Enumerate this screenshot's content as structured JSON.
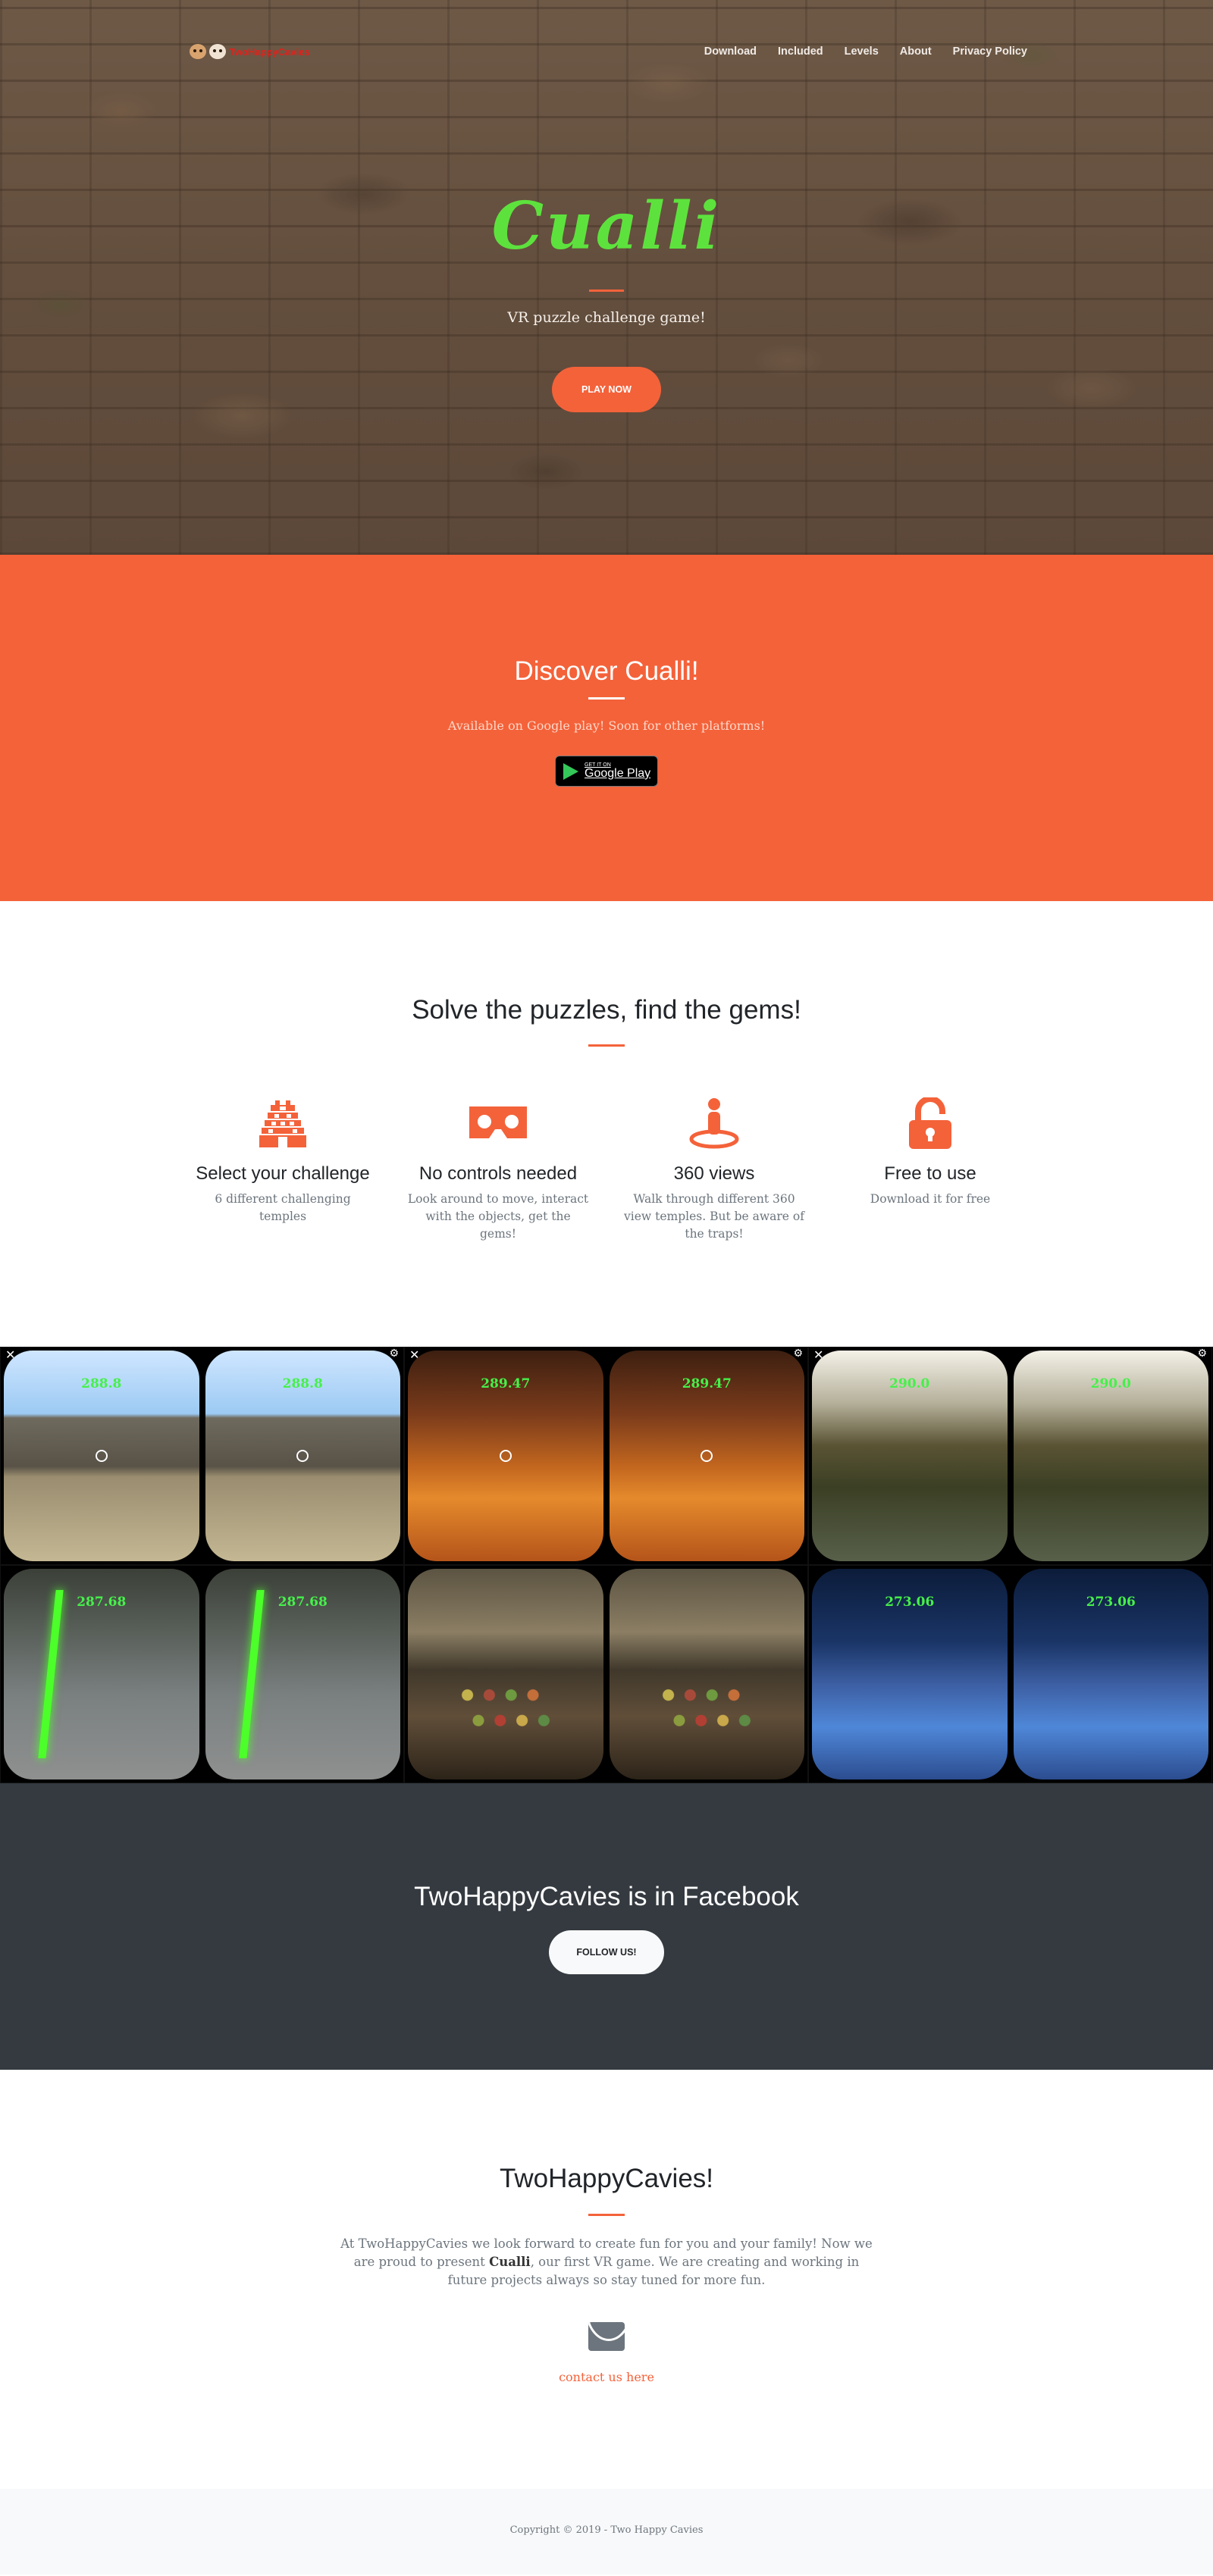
{
  "nav": {
    "logo_text": "TwoHappyCavies",
    "links": [
      "Download",
      "Included",
      "Levels",
      "About",
      "Privacy Policy"
    ]
  },
  "hero": {
    "title": "Cualli",
    "subtitle": "VR puzzle challenge game!",
    "cta": "PLAY NOW"
  },
  "discover": {
    "title": "Discover Cualli!",
    "text": "Available on Google play! Soon for other platforms!",
    "badge_small": "GET IT ON",
    "badge_big": "Google Play"
  },
  "features": {
    "title": "Solve the puzzles, find the gems!",
    "items": [
      {
        "icon": "temple-icon",
        "title": "Select your challenge",
        "text": "6 different challenging temples"
      },
      {
        "icon": "vr-headset-icon",
        "title": "No controls needed",
        "text": "Look around to move, interact with the objects, get the gems!"
      },
      {
        "icon": "person-360-icon",
        "title": "360 views",
        "text": "Walk through different 360 view temples. But be aware of the traps!"
      },
      {
        "icon": "unlock-icon",
        "title": "Free to use",
        "text": "Download it for free"
      }
    ]
  },
  "gallery": {
    "shots": [
      {
        "hud": "288.8"
      },
      {
        "hud": "289.47"
      },
      {
        "hud": "290.0"
      },
      {
        "hud": "287.68"
      },
      {
        "hud": ""
      },
      {
        "hud": "273.06"
      }
    ]
  },
  "facebook": {
    "title": "TwoHappyCavies is in Facebook",
    "button": "FOLLOW US!"
  },
  "about": {
    "title": "TwoHappyCavies!",
    "text_before": "At TwoHappyCavies we look forward to create fun for you and your family! Now we are proud to present ",
    "text_bold": "Cualli",
    "text_after": ", our first VR game. We are creating and working in future projects always so stay tuned for more fun.",
    "contact": "contact us here"
  },
  "footer": {
    "copyright": "Copyright © 2019 - Two Happy Cavies"
  },
  "colors": {
    "accent": "#f4623a",
    "hero_title": "#5de23d",
    "dark": "#343a40"
  }
}
